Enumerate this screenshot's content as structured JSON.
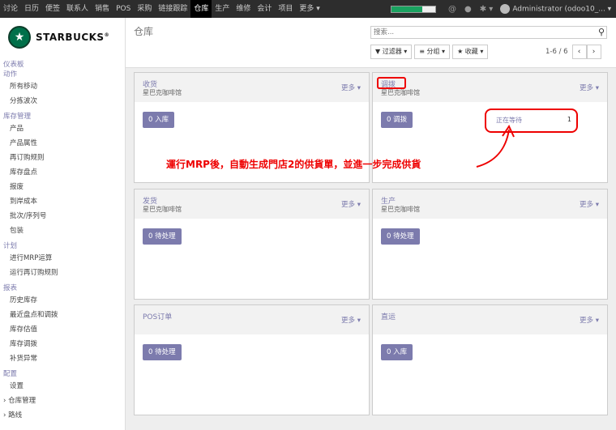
{
  "topbar": {
    "menu": [
      "讨论",
      "日历",
      "便签",
      "联系人",
      "销售",
      "POS",
      "采购",
      "链接跟踪",
      "仓库",
      "生产",
      "维修",
      "会计",
      "项目",
      "更多 ▾"
    ],
    "active": "仓库",
    "user": "Administrator (odoo10_... ▾",
    "progress": 0.7,
    "accent": "#1aa260"
  },
  "logo": {
    "brand": "STARBUCKS",
    "trademark": "®",
    "icon": "starbucks-siren-icon"
  },
  "sidebar": {
    "sections": [
      {
        "title": "仪表板",
        "items": []
      },
      {
        "title": "动作",
        "items": [
          "所有移动",
          "分拣波次"
        ]
      },
      {
        "title": "库存管理",
        "items": [
          "产品",
          "产品属性",
          "再订购规则",
          "库存盘点",
          "报废",
          "到岸成本",
          "批次/序列号",
          "包装"
        ]
      },
      {
        "title": "计划",
        "items": [
          "进行MRP运算",
          "运行再订购规则"
        ]
      },
      {
        "title": "报表",
        "items": [
          "历史库存",
          "最近盘点和调拨",
          "库存估值",
          "库存调拨",
          "补货异常"
        ]
      },
      {
        "title": "配置",
        "items": [
          "设置",
          "仓库管理",
          "路线"
        ]
      }
    ]
  },
  "control_panel": {
    "title": "仓库",
    "search_placeholder": "搜索...",
    "filters": "▼ 过滤器 ▾",
    "group": "≡ 分组 ▾",
    "favorites": "★ 收藏 ▾",
    "pager": "1-6 / 6"
  },
  "cards": [
    {
      "name": "收货",
      "sub": "星巴克咖啡馆",
      "more": "更多 ▾",
      "button": "0 入库"
    },
    {
      "name": "调拨",
      "sub": "星巴克咖啡馆",
      "more": "更多 ▾",
      "button": "0 调拨",
      "waiting_label": "正在等待",
      "waiting_count": "1"
    },
    {
      "name": "发货",
      "sub": "星巴克咖啡馆",
      "more": "更多 ▾",
      "button": "0 待处理"
    },
    {
      "name": "生产",
      "sub": "星巴克咖啡馆",
      "more": "更多 ▾",
      "button": "0 待处理"
    },
    {
      "name": "POS订单",
      "sub": "",
      "more": "更多 ▾",
      "button": "0 待处理"
    },
    {
      "name": "直运",
      "sub": "",
      "more": "更多 ▾",
      "button": "0 入库"
    }
  ],
  "annotation": "運行MRP後，自動生成門店2的供貨單，並進一步完成供貨",
  "colors": {
    "accent": "#7c7bad",
    "highlight": "#e00000",
    "brand_green": "#00704a"
  }
}
